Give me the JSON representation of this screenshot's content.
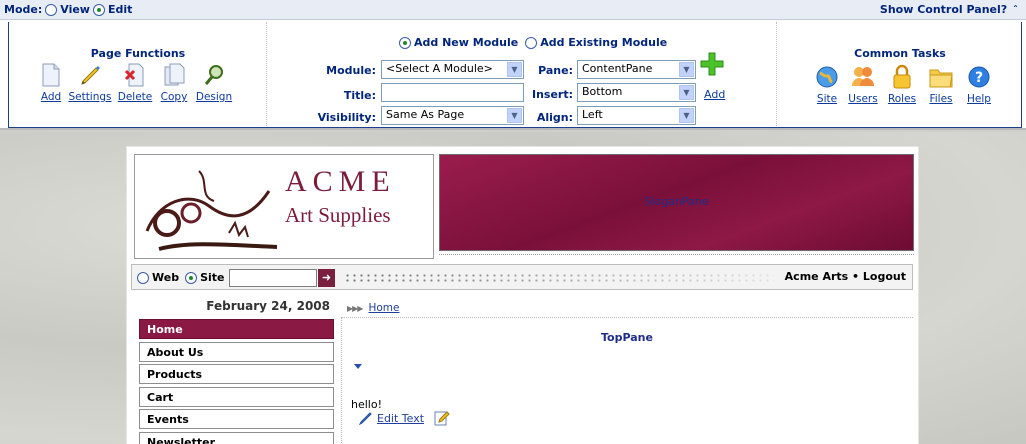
{
  "control_bar": {
    "mode_label": "Mode:",
    "mode_view": "View",
    "mode_edit": "Edit",
    "mode_selected": "Edit",
    "show_control_panel": "Show Control Panel?"
  },
  "page_functions": {
    "title": "Page Functions",
    "items": [
      {
        "label": "Add",
        "icon": "add-page-icon"
      },
      {
        "label": "Settings",
        "icon": "settings-pencil-icon"
      },
      {
        "label": "Delete",
        "icon": "delete-page-icon"
      },
      {
        "label": "Copy",
        "icon": "copy-page-icon"
      },
      {
        "label": "Design",
        "icon": "design-magnifier-icon"
      }
    ]
  },
  "module_panel": {
    "add_new_label": "Add New Module",
    "add_existing_label": "Add Existing Module",
    "selected_option": "Add New Module",
    "module_label": "Module:",
    "module_value": "<Select A Module>",
    "title_label": "Title:",
    "title_value": "",
    "visibility_label": "Visibility:",
    "visibility_value": "Same As Page",
    "pane_label": "Pane:",
    "pane_value": "ContentPane",
    "insert_label": "Insert:",
    "insert_value": "Bottom",
    "align_label": "Align:",
    "align_value": "Left",
    "add_label": "Add"
  },
  "common_tasks": {
    "title": "Common Tasks",
    "items": [
      {
        "label": "Site",
        "icon": "site-globe-icon"
      },
      {
        "label": "Users",
        "icon": "users-icon"
      },
      {
        "label": "Roles",
        "icon": "roles-lock-icon"
      },
      {
        "label": "Files",
        "icon": "files-folder-icon"
      },
      {
        "label": "Help",
        "icon": "help-icon"
      }
    ]
  },
  "site": {
    "logo_line1": "ACME",
    "logo_line2": "Art Supplies",
    "slogan_pane": "SloganPane",
    "search_web": "Web",
    "search_site": "Site",
    "search_selected": "Site",
    "user_name": "Acme Arts",
    "separator": "•",
    "logout": "Logout",
    "date": "February 24, 2008",
    "nav_items": [
      "Home",
      "About Us",
      "Products",
      "Cart",
      "Events",
      "Newsletter"
    ],
    "active_nav": "Home",
    "breadcrumb": "Home",
    "top_pane": "TopPane",
    "hello_text": "hello!",
    "edit_text": "Edit Text"
  },
  "colors": {
    "cp_text": "#00257a",
    "link": "#0b3a9b",
    "brand": "#8a1a44",
    "slogan_bg": "#8a1a44"
  }
}
